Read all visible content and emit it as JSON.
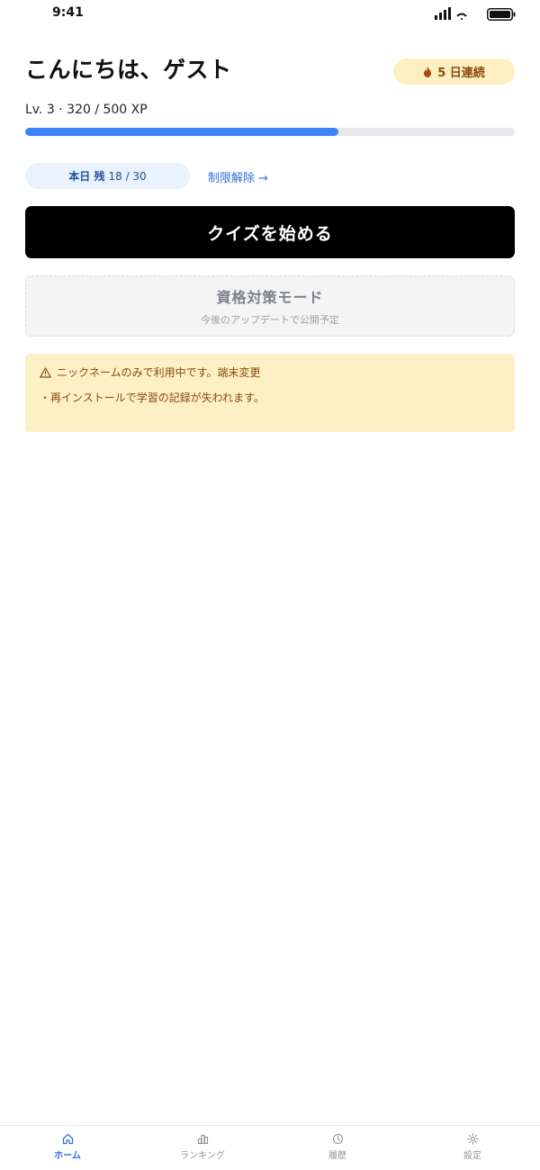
{
  "status_bar": {
    "time": "9:41"
  },
  "header": {
    "greeting": "こんにちは、ゲスト",
    "streak": "5 日連続"
  },
  "xp": {
    "text": "Lv. 3 · 320 / 500 XP",
    "current": 320,
    "max": 500
  },
  "quota": {
    "label": "本日 残",
    "value": "18 / 30",
    "unlock_link": "制限解除 →"
  },
  "actions": {
    "start_quiz": "クイズを始める"
  },
  "exam_mode": {
    "title": "資格対策モード",
    "subtitle": "今後のアップデートで公開予定"
  },
  "warning": {
    "line1": "ニックネームのみで利用中です。端末変更",
    "line2": "・再インストールで学習の記録が失われます。"
  },
  "nav": {
    "items": [
      {
        "label": "ホーム",
        "icon": "home-icon",
        "active": true
      },
      {
        "label": "ランキング",
        "icon": "ranking-icon",
        "active": false
      },
      {
        "label": "履歴",
        "icon": "history-icon",
        "active": false
      },
      {
        "label": "設定",
        "icon": "settings-icon",
        "active": false
      }
    ]
  },
  "colors": {
    "accent": "#3b82f6",
    "link": "#2f6fd6",
    "streak_bg": "#fdefc0",
    "warning_bg": "#fdf0c4",
    "warning_text": "#8a4a0e",
    "button_bg": "#000000"
  }
}
